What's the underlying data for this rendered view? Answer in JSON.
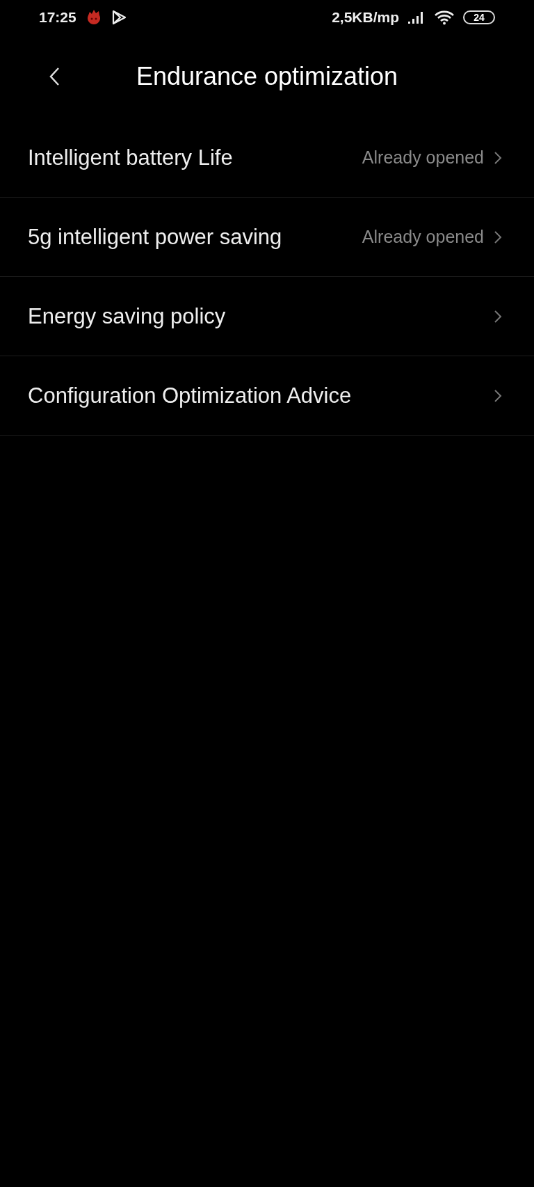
{
  "status_bar": {
    "time": "17:25",
    "network_speed": "2,5KB/mp",
    "battery": "24"
  },
  "header": {
    "title": "Endurance optimization"
  },
  "items": [
    {
      "label": "Intelligent battery Life",
      "value": "Already opened"
    },
    {
      "label": "5g intelligent power saving",
      "value": "Already opened"
    },
    {
      "label": "Energy saving policy"
    },
    {
      "label": "Configuration Optimization Advice"
    }
  ]
}
